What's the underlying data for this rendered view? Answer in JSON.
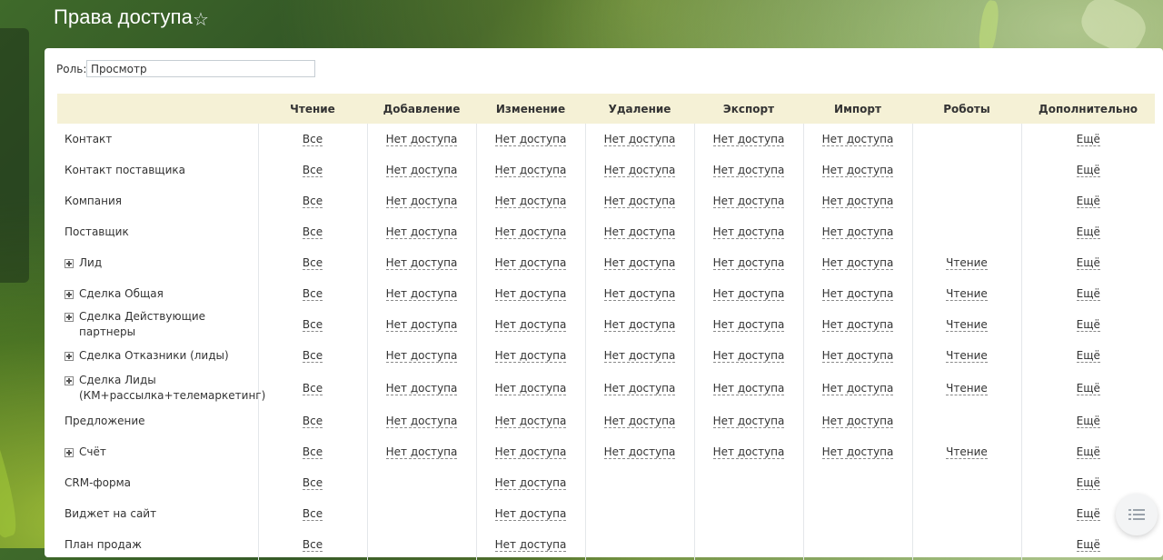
{
  "page": {
    "title": "Права доступа"
  },
  "role": {
    "label": "Роль:",
    "value": "Просмотр"
  },
  "columns": [
    "",
    "Чтение",
    "Добавление",
    "Изменение",
    "Удаление",
    "Экспорт",
    "Импорт",
    "Роботы",
    "Дополнительно"
  ],
  "rows": [
    {
      "entity": "Контакт",
      "expandable": false,
      "cells": [
        "Все",
        "Нет доступа",
        "Нет доступа",
        "Нет доступа",
        "Нет доступа",
        "Нет доступа",
        "",
        "Ещё"
      ]
    },
    {
      "entity": "Контакт поставщика",
      "expandable": false,
      "cells": [
        "Все",
        "Нет доступа",
        "Нет доступа",
        "Нет доступа",
        "Нет доступа",
        "Нет доступа",
        "",
        "Ещё"
      ]
    },
    {
      "entity": "Компания",
      "expandable": false,
      "cells": [
        "Все",
        "Нет доступа",
        "Нет доступа",
        "Нет доступа",
        "Нет доступа",
        "Нет доступа",
        "",
        "Ещё"
      ]
    },
    {
      "entity": "Поставщик",
      "expandable": false,
      "cells": [
        "Все",
        "Нет доступа",
        "Нет доступа",
        "Нет доступа",
        "Нет доступа",
        "Нет доступа",
        "",
        "Ещё"
      ]
    },
    {
      "entity": "Лид",
      "expandable": true,
      "cells": [
        "Все",
        "Нет доступа",
        "Нет доступа",
        "Нет доступа",
        "Нет доступа",
        "Нет доступа",
        "Чтение",
        "Ещё"
      ]
    },
    {
      "entity": "Сделка Общая",
      "expandable": true,
      "cells": [
        "Все",
        "Нет доступа",
        "Нет доступа",
        "Нет доступа",
        "Нет доступа",
        "Нет доступа",
        "Чтение",
        "Ещё"
      ]
    },
    {
      "entity": "Сделка Действующие партнеры",
      "expandable": true,
      "cells": [
        "Все",
        "Нет доступа",
        "Нет доступа",
        "Нет доступа",
        "Нет доступа",
        "Нет доступа",
        "Чтение",
        "Ещё"
      ]
    },
    {
      "entity": "Сделка Отказники (лиды)",
      "expandable": true,
      "cells": [
        "Все",
        "Нет доступа",
        "Нет доступа",
        "Нет доступа",
        "Нет доступа",
        "Нет доступа",
        "Чтение",
        "Ещё"
      ]
    },
    {
      "entity": "Сделка Лиды (КМ+рассылка+телемаркетинг)",
      "expandable": true,
      "cells": [
        "Все",
        "Нет доступа",
        "Нет доступа",
        "Нет доступа",
        "Нет доступа",
        "Нет доступа",
        "Чтение",
        "Ещё"
      ]
    },
    {
      "entity": "Предложение",
      "expandable": false,
      "cells": [
        "Все",
        "Нет доступа",
        "Нет доступа",
        "Нет доступа",
        "Нет доступа",
        "Нет доступа",
        "",
        "Ещё"
      ]
    },
    {
      "entity": "Счёт",
      "expandable": true,
      "cells": [
        "Все",
        "Нет доступа",
        "Нет доступа",
        "Нет доступа",
        "Нет доступа",
        "Нет доступа",
        "Чтение",
        "Ещё"
      ]
    },
    {
      "entity": "CRM-форма",
      "expandable": false,
      "cells": [
        "Все",
        "",
        "Нет доступа",
        "",
        "",
        "",
        "",
        "Ещё"
      ]
    },
    {
      "entity": "Виджет на сайт",
      "expandable": false,
      "cells": [
        "Все",
        "",
        "Нет доступа",
        "",
        "",
        "",
        "",
        "Ещё"
      ]
    },
    {
      "entity": "План продаж",
      "expandable": false,
      "cells": [
        "Все",
        "",
        "Нет доступа",
        "",
        "",
        "",
        "",
        "Ещё"
      ]
    }
  ]
}
